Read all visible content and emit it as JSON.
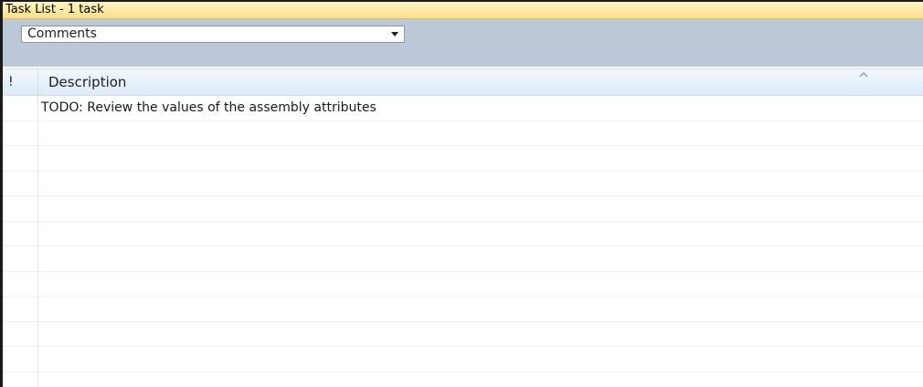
{
  "panel": {
    "title": "Task List - 1 task"
  },
  "filter": {
    "selected": "Comments",
    "chevron_icon": "chevron-down-icon"
  },
  "columns": {
    "priority": "!",
    "description": "Description",
    "sort_icon": "sort-ascending-icon"
  },
  "tasks": [
    {
      "description": "TODO: Review the values of the assembly attributes"
    }
  ],
  "colors": {
    "title_bar": "#fde9a3",
    "toolbar": "#bcc7d8",
    "header": "#dcebf8"
  }
}
